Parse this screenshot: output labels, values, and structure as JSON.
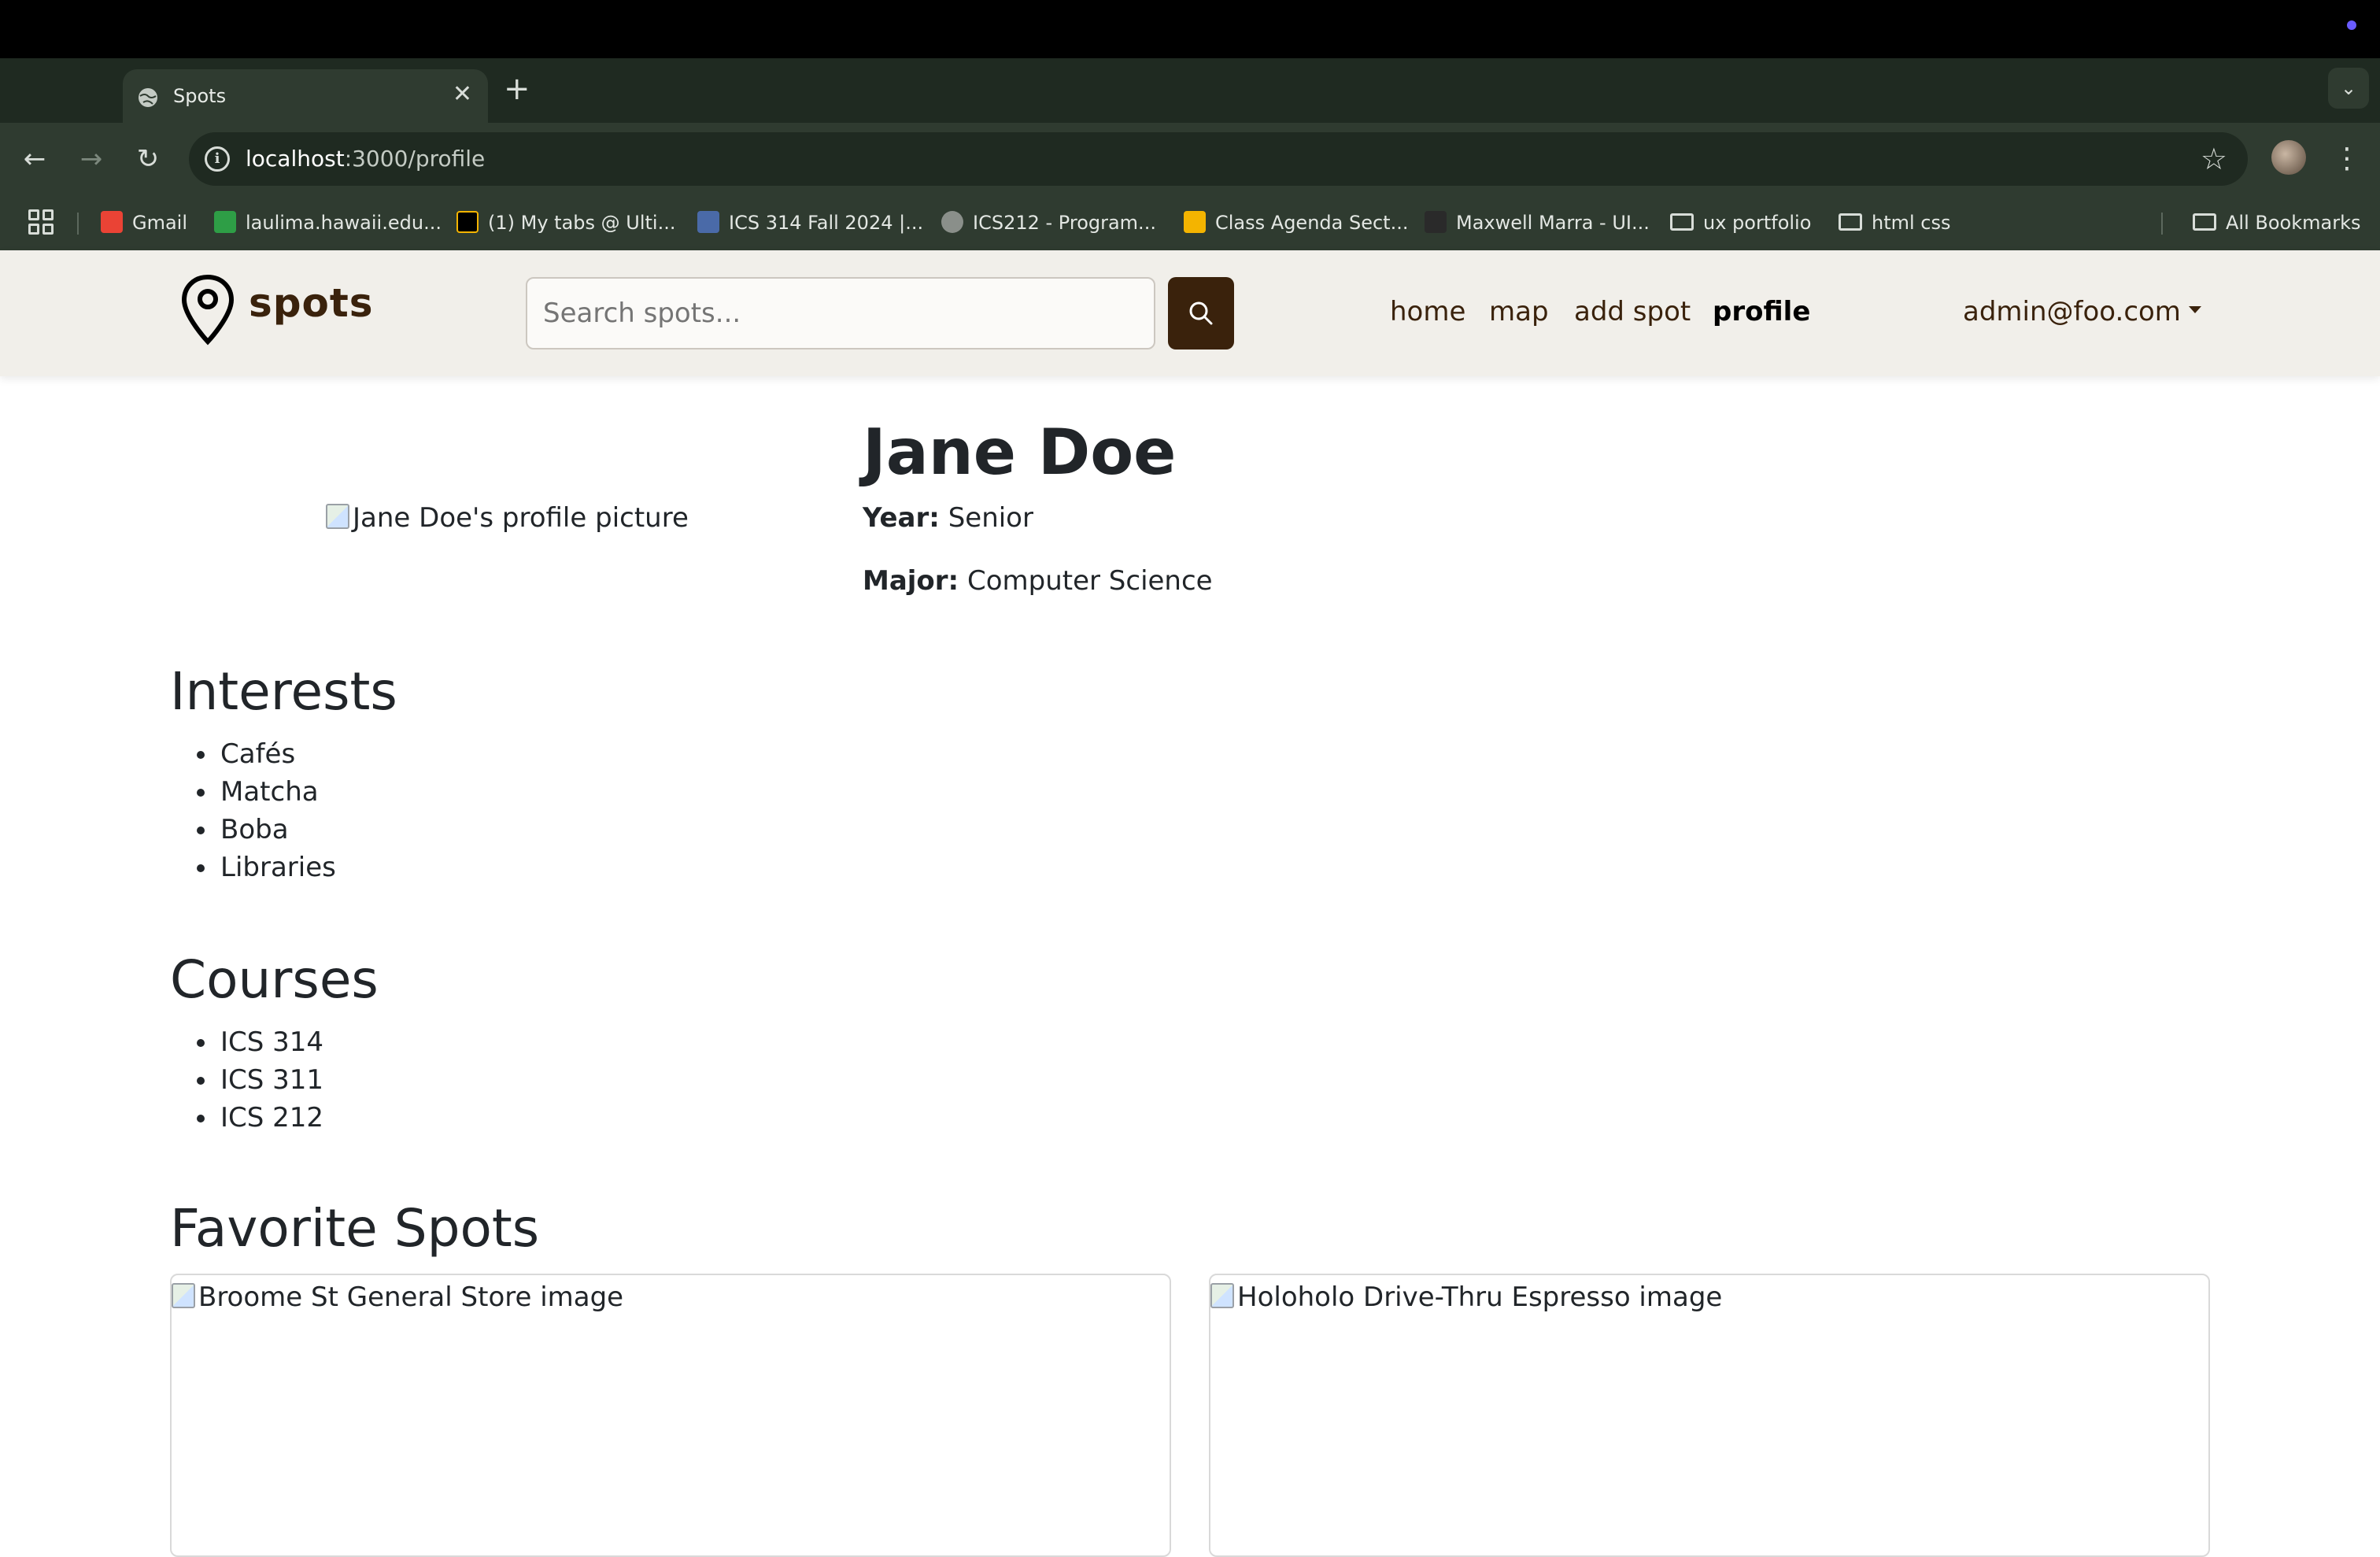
{
  "browser": {
    "tab_title": "Spots",
    "url_host": "localhost",
    "url_path": ":3000/profile",
    "bookmarks": [
      {
        "label": "Gmail",
        "color": "#ea4335"
      },
      {
        "label": "laulima.hawaii.edu...",
        "color": "#2e9e46"
      },
      {
        "label": "(1) My tabs @ Ulti...",
        "color": "#000000"
      },
      {
        "label": "ICS 314 Fall 2024 |...",
        "color": "#4a6aa8"
      },
      {
        "label": "ICS212 - Program...",
        "color": "#8a8f8a"
      },
      {
        "label": "Class Agenda Sect...",
        "color": "#f4b400"
      },
      {
        "label": "Maxwell Marra - UI...",
        "color": "#2a2a2a"
      },
      {
        "label": "ux portfolio",
        "color": "folder"
      },
      {
        "label": "html css",
        "color": "folder"
      }
    ],
    "all_bookmarks": "All Bookmarks"
  },
  "navbar": {
    "brand": "spots",
    "search_placeholder": "Search spots...",
    "links": [
      "home",
      "map",
      "add spot",
      "profile"
    ],
    "active_link": "profile",
    "user": "admin@foo.com"
  },
  "profile": {
    "image_alt": "Jane Doe's profile picture",
    "name": "Jane Doe",
    "year_label": "Year:",
    "year": "Senior",
    "major_label": "Major:",
    "major": "Computer Science"
  },
  "interests": {
    "title": "Interests",
    "items": [
      "Cafés",
      "Matcha",
      "Boba",
      "Libraries"
    ]
  },
  "courses": {
    "title": "Courses",
    "items": [
      "ICS 314",
      "ICS 311",
      "ICS 212"
    ]
  },
  "favorites": {
    "title": "Favorite Spots",
    "cards": [
      {
        "image_alt": "Broome St General Store image"
      },
      {
        "image_alt": "Holoholo Drive-Thru Espresso image"
      }
    ]
  },
  "colors": {
    "brand_brown": "#3a220c",
    "navbar_bg": "#f1efea"
  }
}
